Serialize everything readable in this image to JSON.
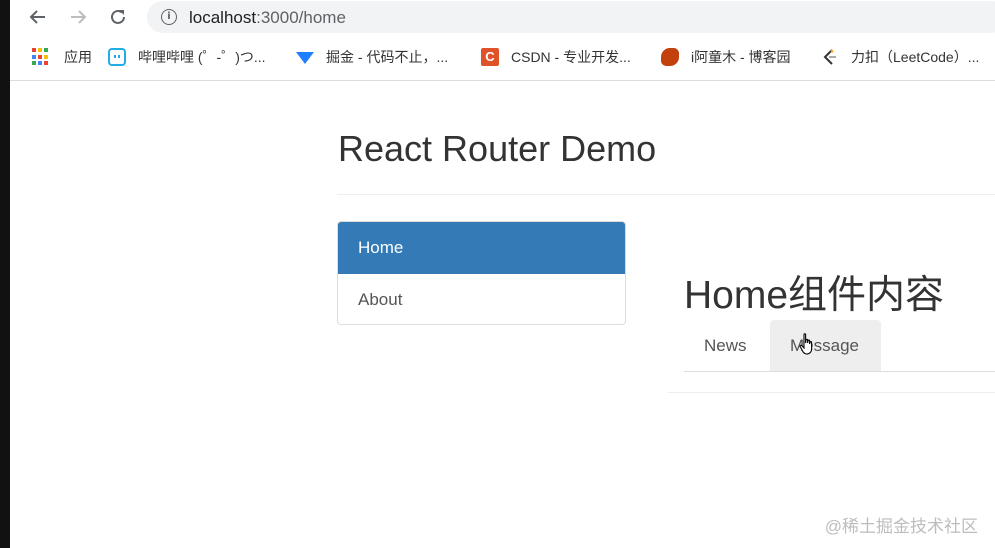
{
  "browser": {
    "url_host": "localhost",
    "url_path": ":3000/home",
    "bookmarks": [
      {
        "label": "应用",
        "icon": "apps-grid-icon"
      },
      {
        "label": "哔哩哔哩 (゜-゜)つ...",
        "icon": "bilibili-icon"
      },
      {
        "label": "掘金 - 代码不止，...",
        "icon": "juejin-icon"
      },
      {
        "label": "CSDN - 专业开发...",
        "icon": "csdn-icon"
      },
      {
        "label": "i阿童木 - 博客园",
        "icon": "cnblogs-icon"
      },
      {
        "label": "力扣（LeetCode）...",
        "icon": "leetcode-icon"
      }
    ]
  },
  "page": {
    "title": "React Router Demo",
    "nav": [
      {
        "label": "Home",
        "active": true
      },
      {
        "label": "About",
        "active": false
      }
    ],
    "home": {
      "heading": "Home组件内容",
      "tabs": [
        {
          "label": "News",
          "hovered": false
        },
        {
          "label": "Message",
          "hovered": true
        }
      ]
    }
  },
  "watermark": "@稀土掘金技术社区",
  "colors": {
    "active_nav": "#337ab7",
    "hover_tab": "#eeeeee",
    "omnibox": "#f1f3f4"
  },
  "icons": {
    "csdn_letter": "C",
    "info_glyph": "i"
  }
}
